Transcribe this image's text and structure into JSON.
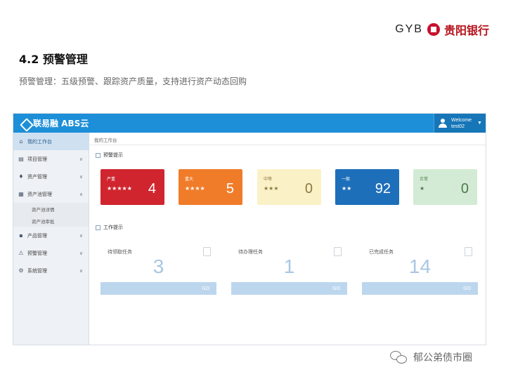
{
  "brand": {
    "en": "GYB",
    "cn": "贵阳银行"
  },
  "slide": {
    "title": "4.2 预警管理",
    "subtitle": "预警管理：五级预警、跟踪资产质量，支持进行资产动态回购"
  },
  "app": {
    "logo": "联易融 ABS云",
    "user": {
      "greeting": "Welcome",
      "name": "test02"
    },
    "sidebar": {
      "items": [
        {
          "label": "我的工作台",
          "icon": "home-icon",
          "active": true
        },
        {
          "label": "项目管理",
          "icon": "database-icon"
        },
        {
          "label": "资产管理",
          "icon": "money-bag-icon"
        },
        {
          "label": "资产池管理",
          "icon": "table-icon",
          "expanded": true,
          "children": [
            "资产池详情",
            "资产池审批"
          ]
        },
        {
          "label": "产品管理",
          "icon": "grid-icon"
        },
        {
          "label": "预警管理",
          "icon": "warning-icon"
        },
        {
          "label": "系统管理",
          "icon": "gear-icon"
        }
      ]
    },
    "breadcrumb": "我的工作台",
    "warnings": {
      "heading": "预警提示",
      "cards": [
        {
          "label": "严重",
          "stars": "★★★★★",
          "count": "4",
          "bg": "#d0252f",
          "fg": "#ffffff"
        },
        {
          "label": "重大",
          "stars": "★★★★",
          "count": "5",
          "bg": "#f07c2a",
          "fg": "#ffffff"
        },
        {
          "label": "中等",
          "stars": "★★★",
          "count": "0",
          "bg": "#fbf1c7",
          "fg": "#8a7a40"
        },
        {
          "label": "一般",
          "stars": "★★",
          "count": "92",
          "bg": "#1d6fba",
          "fg": "#ffffff"
        },
        {
          "label": "正常",
          "stars": "★",
          "count": "0",
          "bg": "#d3ebd4",
          "fg": "#4c7a4d"
        }
      ]
    },
    "work": {
      "heading": "工作提示",
      "tasks": [
        {
          "label": "待领取任务",
          "count": "3",
          "go": "GO"
        },
        {
          "label": "待办理任务",
          "count": "1",
          "go": "GO"
        },
        {
          "label": "已完成任务",
          "count": "14",
          "go": "GO"
        }
      ]
    }
  },
  "watermark": "郁公弟债市圈"
}
